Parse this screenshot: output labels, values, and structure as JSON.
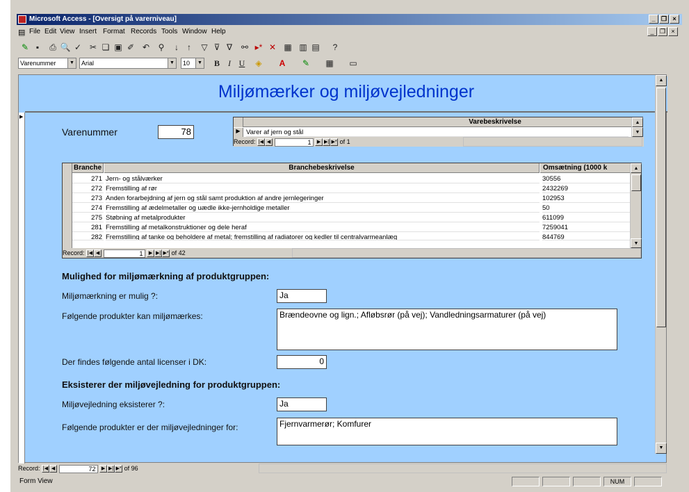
{
  "window": {
    "title": "Microsoft Access - [Oversigt på varerniveau]"
  },
  "menu": [
    "File",
    "Edit",
    "View",
    "Insert",
    "Format",
    "Records",
    "Tools",
    "Window",
    "Help"
  ],
  "formatting_toolbar": {
    "object_combo": "Varenummer",
    "font_combo": "Arial",
    "size_combo": "10"
  },
  "form": {
    "title": "Miljømærker og miljøvejledninger",
    "varenummer_label": "Varenummer",
    "varenummer_value": "78",
    "varebeskrivelse": {
      "header": "Varebeskrivelse",
      "rows": [
        "Varer af jern og stål"
      ],
      "nav": {
        "label": "Record:",
        "current": "1",
        "of": "of 1"
      }
    },
    "branche_grid": {
      "headers": [
        "Branche",
        "Branchebeskrivelse",
        "Omsætning (1000 k"
      ],
      "rows": [
        [
          "271",
          "Jern- og stålværker",
          "30556"
        ],
        [
          "272",
          "Fremstilling af rør",
          "2432269"
        ],
        [
          "273",
          "Anden forarbejdning af jern og stål samt produktion af andre jernlegeringer",
          "102953"
        ],
        [
          "274",
          "Fremstilling af ædelmetaller og uædle ikke-jernholdige metaller",
          "50"
        ],
        [
          "275",
          "Støbning af metalprodukter",
          "611099"
        ],
        [
          "281",
          "Fremstilling af metalkonstruktioner og dele heraf",
          "7259041"
        ],
        [
          "282",
          "Fremstilling af tanke og beholdere af metal; fremstilling af radiatorer og kedler til centralvarmeanlæg",
          "844769"
        ]
      ],
      "nav": {
        "label": "Record:",
        "current": "1",
        "of": "of 42"
      }
    },
    "section1_heading": "Mulighed for miljømærkning af produktgruppen:",
    "miljomaerkning_label": "Miljømærkning er mulig ?:",
    "miljomaerkning_value": "Ja",
    "produkter_label": "Følgende produkter kan miljømærkes:",
    "produkter_value": "Brændeovne og lign.; Afløbsrør (på vej); Vandledningsarmaturer (på vej)",
    "licenser_label": "Der findes følgende antal licenser i DK:",
    "licenser_value": "0",
    "section2_heading": "Eksisterer der miljøvejledning for produktgruppen:",
    "vejledning_label": "Miljøvejledning eksisterer ?:",
    "vejledning_value": "Ja",
    "vejledning_produkter_label": "Følgende produkter er der miljøvejledninger for:",
    "vejledning_produkter_value": "Fjernvarmerør; Komfurer"
  },
  "main_nav": {
    "label": "Record:",
    "current": "72",
    "of": "of 96"
  },
  "status": {
    "left": "Form View",
    "num": "NUM"
  }
}
